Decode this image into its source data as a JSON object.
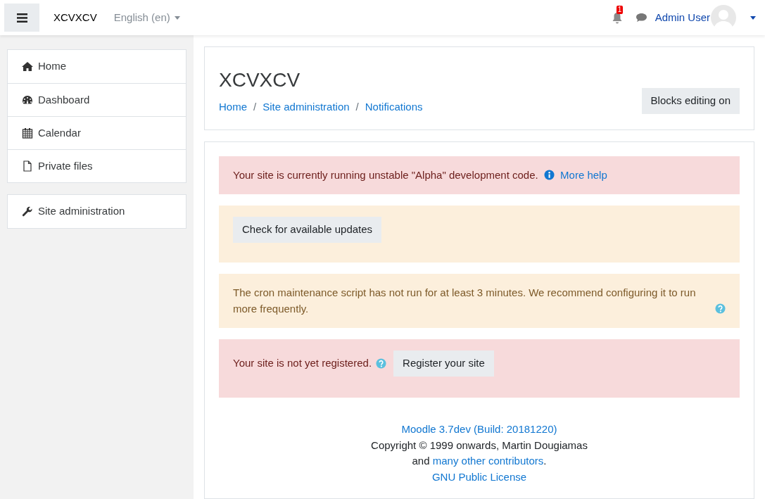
{
  "navbar": {
    "site_name": "XCVXCV",
    "language": "English (en)",
    "notification_count": "1",
    "user_name": "Admin User"
  },
  "nav_blocks": [
    {
      "items": [
        {
          "label": "Home"
        },
        {
          "label": "Dashboard"
        },
        {
          "label": "Calendar"
        },
        {
          "label": "Private files"
        }
      ]
    },
    {
      "items": [
        {
          "label": "Site administration"
        }
      ]
    }
  ],
  "header": {
    "title": "XCVXCV",
    "breadcrumb": [
      "Home",
      "Site administration",
      "Notifications"
    ],
    "separator": "/",
    "button": "Blocks editing on"
  },
  "alerts": [
    {
      "kind": "development",
      "message": "Your site is currently running unstable \"Alpha\" development code.",
      "link": "More help"
    },
    {
      "kind": "updates",
      "button": "Check for available updates"
    },
    {
      "kind": "cron",
      "message": "The cron maintenance script has not run for at least 3 minutes. We recommend configuring it to run more frequently."
    },
    {
      "kind": "registration",
      "message": "Your site is not yet registered.",
      "button": "Register your site"
    }
  ],
  "footer": {
    "version_link": "Moodle 3.7dev (Build: 20181220)",
    "copyright": "Copyright © 1999 onwards, Martin Dougiamas",
    "contributors": {
      "before": "and ",
      "link": "many other contributors",
      "after": "."
    },
    "license_link": "GNU Public License"
  }
}
